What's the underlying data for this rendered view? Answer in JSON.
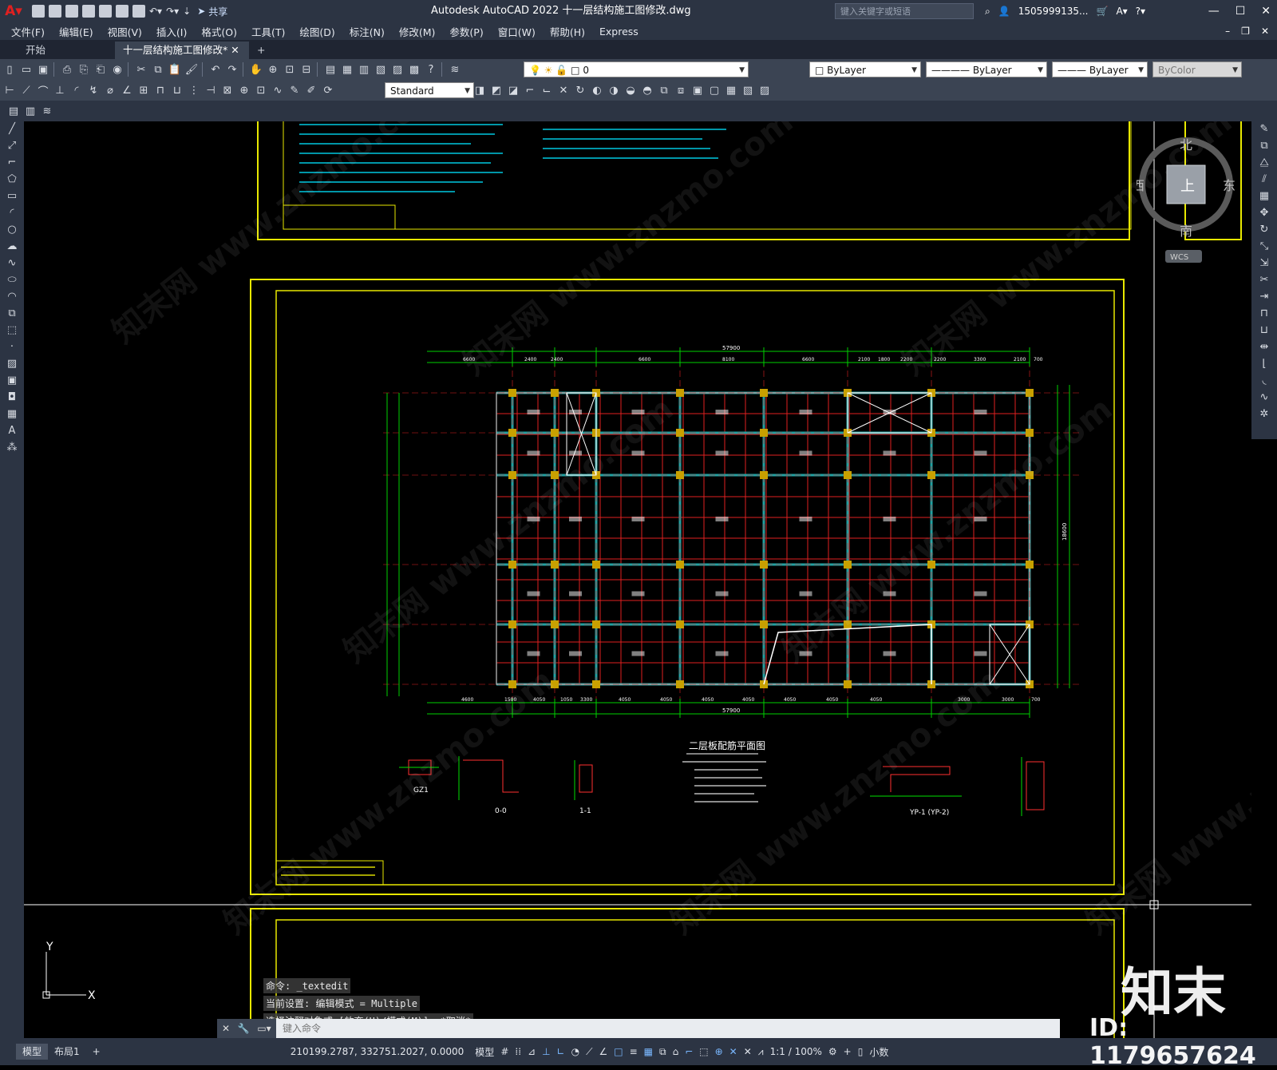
{
  "app": {
    "title": "Autodesk AutoCAD 2022    十一层结构施工图修改.dwg",
    "search_placeholder": "键入关键字或短语",
    "user": "1505999135...",
    "share": "共享"
  },
  "menu": [
    "文件(F)",
    "编辑(E)",
    "视图(V)",
    "插入(I)",
    "格式(O)",
    "工具(T)",
    "绘图(D)",
    "标注(N)",
    "修改(M)",
    "参数(P)",
    "窗口(W)",
    "帮助(H)",
    "Express"
  ],
  "tabs": {
    "start": "开始",
    "doc": "十一层结构施工图修改*",
    "add": "+"
  },
  "toolbar": {
    "layer": "0",
    "text_style": "Standard",
    "color": "ByLayer",
    "linetype": "ByLayer",
    "lineweight": "ByLayer",
    "plotstyle": "ByColor"
  },
  "viewcube": {
    "north": "北",
    "south": "南",
    "east": "东",
    "west": "西",
    "top": "上",
    "wcs": "WCS"
  },
  "drawing": {
    "plan_title": "二层板配筋平面图",
    "total_dim": "57900",
    "right_dim": "18600",
    "ucs_y": "Y",
    "ucs_x": "X",
    "section_labels": [
      "GZ1",
      "0-0",
      "1-1",
      "YP-1  (YP-2)"
    ],
    "bottom_dims": [
      "4600",
      "1500",
      "4050",
      "1050",
      "3300",
      "4050",
      "4050",
      "4050",
      "4050",
      "4050",
      "4050",
      "4050",
      "3000",
      "3000",
      "700"
    ],
    "top_dims": [
      "6600",
      "2400",
      "2400",
      "6600",
      "8100",
      "6600",
      "2100",
      "1800",
      "2200",
      "2200",
      "3300",
      "2100",
      "700"
    ]
  },
  "command": {
    "history": [
      "命令: _textedit",
      "当前设置: 编辑模式 = Multiple",
      "选择注释对象或 [放弃(U)/模式(M)]: *取消*"
    ],
    "placeholder": "键入命令"
  },
  "status": {
    "tabs": [
      "模型",
      "布局1",
      "+"
    ],
    "coords": "210199.2787, 332751.2027, 0.0000",
    "space": "模型",
    "scale": "1:1 / 100%",
    "units": "小数"
  },
  "overlay": {
    "brand": "知末",
    "id": "ID: 1179657624"
  }
}
